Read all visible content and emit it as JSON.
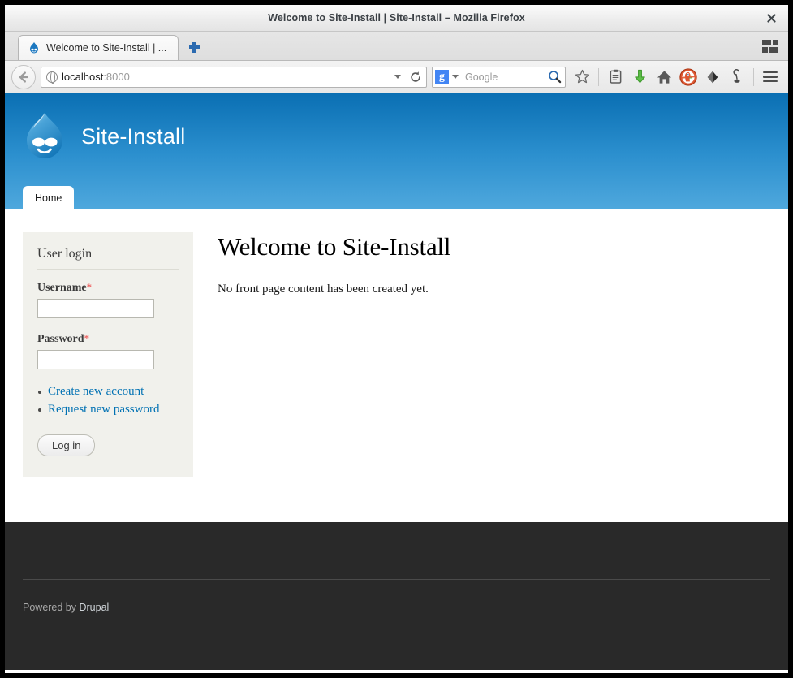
{
  "window": {
    "title": "Welcome to Site-Install | Site-Install – Mozilla Firefox",
    "close_label": "✖"
  },
  "browser": {
    "tab": {
      "label": "Welcome to Site-Install | ...",
      "favicon": "drupal-droplet-icon"
    },
    "new_tab_label": "+",
    "list_all_tabs": "list-all-tabs-icon",
    "back_button": "back-arrow-icon",
    "url": {
      "host": "localhost",
      "port": ":8000",
      "identity_icon": "globe-icon",
      "dropdown_icon": "chevron-down-icon",
      "reload_icon": "reload-icon"
    },
    "search": {
      "engine_glyph": "g",
      "engine_name": "Google",
      "placeholder": "Google",
      "go_icon": "magnifier-icon"
    },
    "toolbar_icons": [
      {
        "name": "bookmark-star-icon",
        "title": "Bookmark this page"
      },
      {
        "name": "reader-list-icon",
        "title": "Reading list"
      },
      {
        "name": "downloads-icon",
        "title": "Downloads"
      },
      {
        "name": "home-icon",
        "title": "Home"
      },
      {
        "name": "duckduckgo-privacy-icon",
        "title": "DuckDuckGo Privacy Essentials"
      },
      {
        "name": "ublock-shield-icon",
        "title": "Extension"
      },
      {
        "name": "lamp-icon",
        "title": "Extension"
      },
      {
        "name": "menu-hamburger-icon",
        "title": "Open menu"
      }
    ]
  },
  "site": {
    "name": "Site-Install",
    "logo": "drupal-droplet-icon",
    "menu": [
      {
        "label": "Home",
        "active": true
      }
    ]
  },
  "sidebar": {
    "block_title": "User login",
    "fields": [
      {
        "label": "Username",
        "required": "*",
        "value": "",
        "name": "username-field"
      },
      {
        "label": "Password",
        "required": "*",
        "value": "",
        "name": "password-field"
      }
    ],
    "links": [
      {
        "label": "Create new account"
      },
      {
        "label": "Request new password"
      }
    ],
    "submit_label": "Log in"
  },
  "main": {
    "title": "Welcome to Site-Install",
    "body": "No front page content has been created yet."
  },
  "footer": {
    "prefix": "Powered by ",
    "link_label": "Drupal"
  },
  "colors": {
    "header_top": "#0a6fb3",
    "header_bottom": "#4fa8dd",
    "link": "#0071b3",
    "sidebar_bg": "#f1f1ec",
    "footer_bg": "#292929",
    "required_star": "#e44444"
  }
}
